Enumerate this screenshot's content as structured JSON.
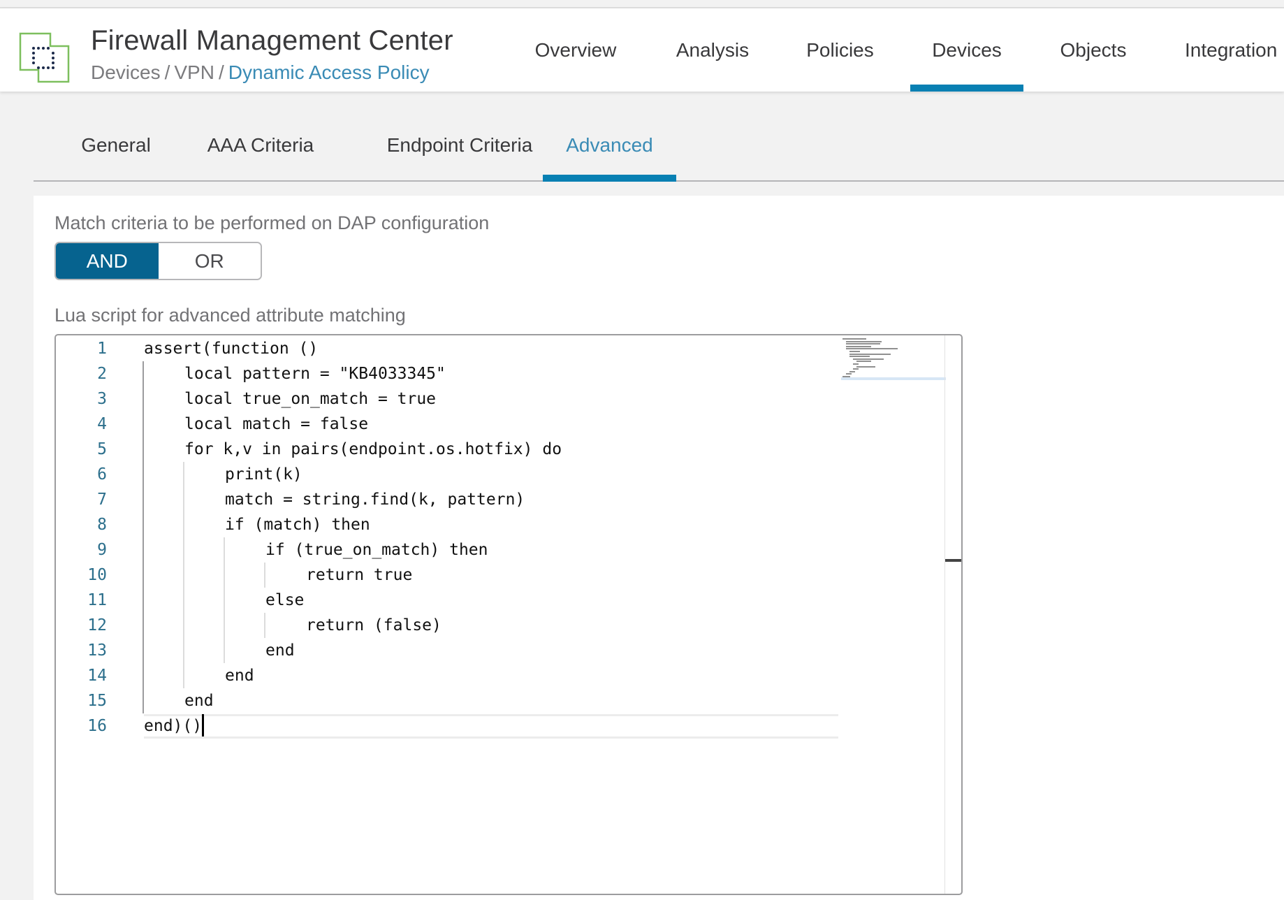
{
  "header": {
    "app_title": "Firewall Management Center",
    "breadcrumb": {
      "items": [
        "Devices",
        "VPN"
      ],
      "separator": "/",
      "current": "Dynamic Access Policy"
    },
    "logo_icon": "fmc-logo-icon",
    "nav": [
      {
        "label": "Overview",
        "active": false
      },
      {
        "label": "Analysis",
        "active": false
      },
      {
        "label": "Policies",
        "active": false
      },
      {
        "label": "Devices",
        "active": true
      },
      {
        "label": "Objects",
        "active": false
      },
      {
        "label": "Integration",
        "active": false
      }
    ]
  },
  "tabs": [
    {
      "label": "General",
      "active": false
    },
    {
      "label": "AAA Criteria",
      "active": false
    },
    {
      "label": "Endpoint Criteria",
      "active": false
    },
    {
      "label": "Advanced",
      "active": true
    }
  ],
  "match_criteria": {
    "label": "Match criteria to be performed on DAP configuration",
    "options": [
      "AND",
      "OR"
    ],
    "selected": "AND"
  },
  "lua_script": {
    "label": "Lua script for advanced attribute matching",
    "current_line": 16,
    "lines": [
      {
        "num": "1",
        "indent": 0,
        "text": "assert(function ()"
      },
      {
        "num": "2",
        "indent": 1,
        "text": "local pattern = \"KB4033345\""
      },
      {
        "num": "3",
        "indent": 1,
        "text": "local true_on_match = true"
      },
      {
        "num": "4",
        "indent": 1,
        "text": "local match = false"
      },
      {
        "num": "5",
        "indent": 1,
        "text": "for k,v in pairs(endpoint.os.hotfix) do"
      },
      {
        "num": "6",
        "indent": 2,
        "text": "print(k)"
      },
      {
        "num": "7",
        "indent": 2,
        "text": "match = string.find(k, pattern)"
      },
      {
        "num": "8",
        "indent": 2,
        "text": "if (match) then"
      },
      {
        "num": "9",
        "indent": 3,
        "text": "if (true_on_match) then"
      },
      {
        "num": "10",
        "indent": 4,
        "text": "return true"
      },
      {
        "num": "11",
        "indent": 3,
        "text": "else"
      },
      {
        "num": "12",
        "indent": 4,
        "text": "return (false)"
      },
      {
        "num": "13",
        "indent": 3,
        "text": "end"
      },
      {
        "num": "14",
        "indent": 2,
        "text": "end"
      },
      {
        "num": "15",
        "indent": 1,
        "text": "end"
      },
      {
        "num": "16",
        "indent": 0,
        "text": "end)()"
      }
    ]
  },
  "colors": {
    "accent": "#0880b3",
    "toggle_active": "#06638f",
    "link": "#3a8bb5",
    "line_number": "#2c6f8c",
    "logo_green": "#7dbf5e",
    "logo_dots": "#1c2a4a"
  }
}
